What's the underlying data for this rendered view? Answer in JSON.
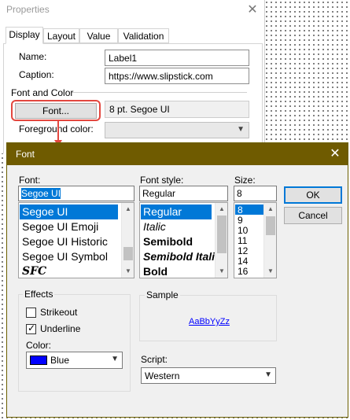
{
  "properties": {
    "title": "Properties",
    "close_glyph": "✕",
    "tabs": [
      {
        "label": "Display",
        "active": true
      },
      {
        "label": "Layout",
        "active": false
      },
      {
        "label": "Value",
        "active": false
      },
      {
        "label": "Validation",
        "active": false
      }
    ],
    "name_label": "Name:",
    "name_value": "Label1",
    "caption_label": "Caption:",
    "caption_value": "https://www.slipstick.com",
    "font_section": "Font and Color",
    "font_button": "Font...",
    "font_value": "8 pt. Segoe UI",
    "foreground_label": "Foreground color:",
    "foreground_value": ""
  },
  "highlight_color": "#e3473f",
  "font_dialog": {
    "title": "Font",
    "close_glyph": "✕",
    "titlebar_color": "#6f5b00",
    "font_label": "Font:",
    "font_value": "Segoe UI",
    "fonts": [
      "Segoe UI",
      "Segoe UI Emoji",
      "Segoe UI Historic",
      "Segoe UI Symbol",
      "SFC"
    ],
    "selected_font": "Segoe UI",
    "style_label": "Font style:",
    "style_value": "Regular",
    "styles": [
      "Regular",
      "Italic",
      "Semibold",
      "Semibold Italic",
      "Bold"
    ],
    "selected_style": "Regular",
    "size_label": "Size:",
    "size_value": "8",
    "sizes": [
      "8",
      "9",
      "10",
      "11",
      "12",
      "14",
      "16"
    ],
    "selected_size": "8",
    "ok_button": "OK",
    "cancel_button": "Cancel",
    "effects_label": "Effects",
    "strikeout_label": "Strikeout",
    "strikeout_checked": false,
    "underline_label": "Underline",
    "underline_checked": true,
    "color_label": "Color:",
    "color_value": "Blue",
    "color_swatch": "#0000ff",
    "sample_label": "Sample",
    "sample_text": "AaBbYyZz",
    "script_label": "Script:",
    "script_value": "Western"
  }
}
